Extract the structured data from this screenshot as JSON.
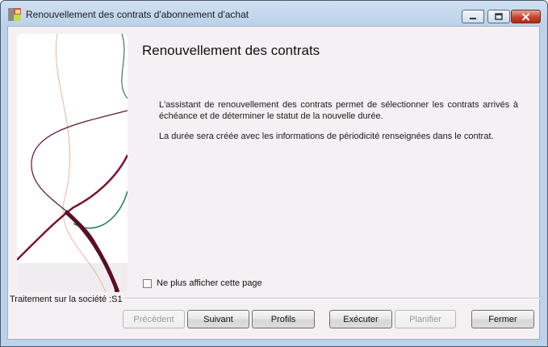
{
  "window": {
    "title": "Renouvellement des contrats d'abonnement d'achat"
  },
  "wizard": {
    "page_title": "Renouvellement des contrats",
    "description_1": "L'assistant de renouvellement des contrats permet de sélectionner les contrats arrivés à échéance et de déterminer le statut de la nouvelle durée.",
    "description_2": "La durée sera créée avec les informations de périodicité renseignées dans le contrat.",
    "checkbox_label": "Ne plus afficher cette page",
    "checkbox_checked": false,
    "company_status": "Traitement sur la société :S1"
  },
  "buttons": {
    "previous": "Précédent",
    "next": "Suivant",
    "profiles": "Profils",
    "execute": "Exécuter",
    "schedule": "Planifier",
    "close": "Fermer"
  },
  "colors": {
    "accent_dark_red": "#7a1430",
    "accent_green": "#1f7a5c",
    "accent_peach": "#e8b59a"
  }
}
